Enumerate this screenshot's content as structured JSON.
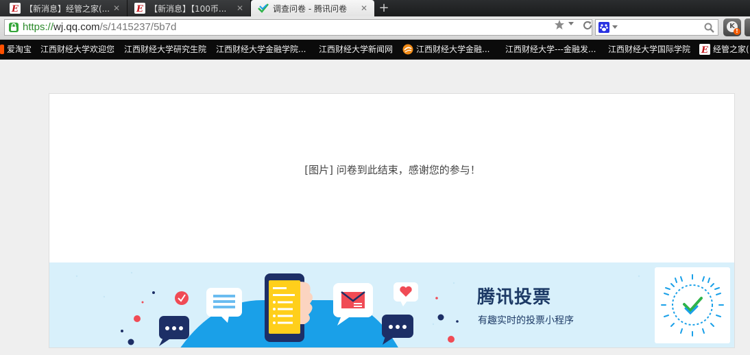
{
  "tabs": [
    {
      "title": "【新消息】经管之家(...",
      "icon": "site-e-icon",
      "active": false
    },
    {
      "title": "【新消息】【100币...",
      "icon": "site-e-icon",
      "active": false
    },
    {
      "title": "调查问卷 - 腾讯问卷",
      "icon": "tencent-wenjuan-icon",
      "active": true
    }
  ],
  "close_glyph": "✕",
  "newtab_glyph": "+",
  "address": {
    "scheme": "https://",
    "host": "wj.qq.com",
    "path": "/s/1415237/5b7d"
  },
  "kbutton": {
    "letter": "K",
    "badge": "!"
  },
  "bookmarks": [
    {
      "label": "爱淘宝",
      "icon": "taobao-icon"
    },
    {
      "label": "江西财经大学欢迎您",
      "icon": null
    },
    {
      "label": "江西财经大学研究生院",
      "icon": null
    },
    {
      "label": "江西财经大学金融学院...",
      "icon": null
    },
    {
      "label": "江西财经大学新闻网",
      "icon": null
    },
    {
      "label": "江西财经大学金融...",
      "icon": "orange-globe-icon"
    },
    {
      "label": "江西财经大学---金融发...",
      "icon": null
    },
    {
      "label": "江西财经大学国际学院",
      "icon": null
    },
    {
      "label": "经管之家(",
      "icon": "site-e-icon"
    }
  ],
  "survey": {
    "end_message": "[图片] 问卷到此结束，感谢您的参与！"
  },
  "banner": {
    "title": "腾讯投票",
    "subtitle": "有趣实时的投票小程序",
    "colors": {
      "background": "#d8f0fb",
      "text": "#1d3a66",
      "accent": "#1aa0e8"
    }
  }
}
